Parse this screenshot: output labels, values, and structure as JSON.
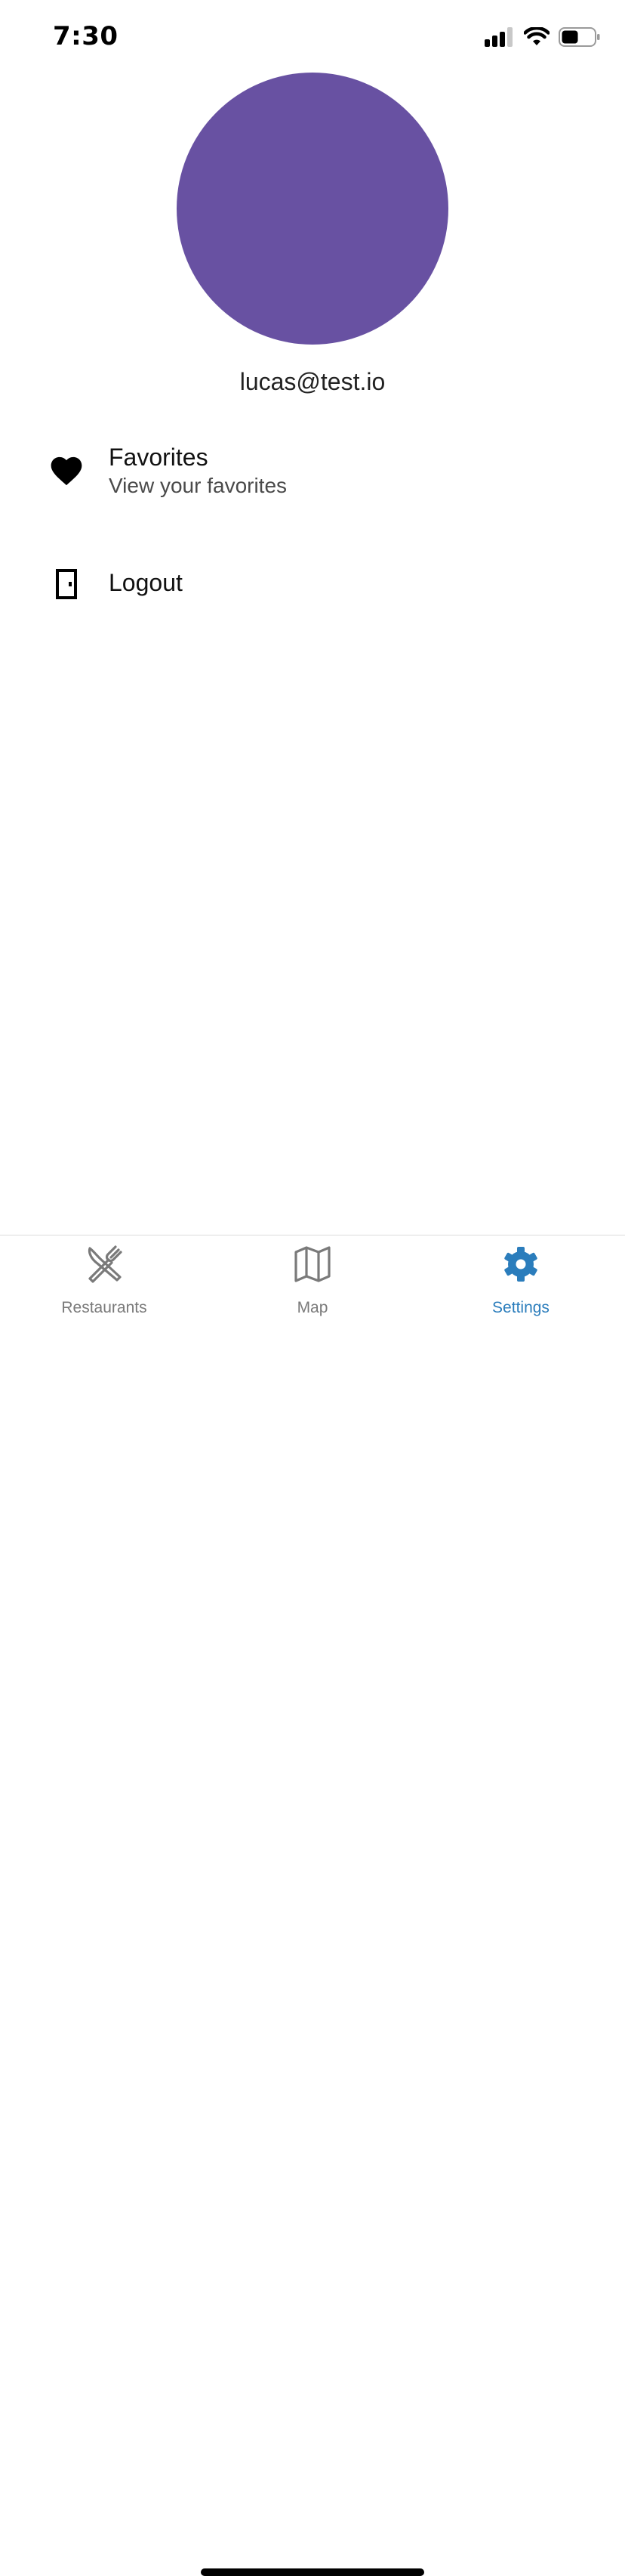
{
  "status_bar": {
    "time": "7:30",
    "icons": [
      "cellular-signal-icon",
      "wifi-icon",
      "battery-icon"
    ]
  },
  "profile": {
    "avatar_color": "#6851a2",
    "email": "lucas@test.io"
  },
  "menu": {
    "favorites": {
      "icon": "heart-icon",
      "title": "Favorites",
      "subtitle": "View your favorites"
    },
    "logout": {
      "icon": "door-icon",
      "title": "Logout"
    }
  },
  "tab_bar": {
    "active_color": "#2b7dbc",
    "inactive_color": "#7a7a7a",
    "tabs": [
      {
        "label": "Restaurants",
        "icon": "utensils-icon",
        "active": false
      },
      {
        "label": "Map",
        "icon": "map-icon",
        "active": false
      },
      {
        "label": "Settings",
        "icon": "gear-icon",
        "active": true
      }
    ]
  }
}
